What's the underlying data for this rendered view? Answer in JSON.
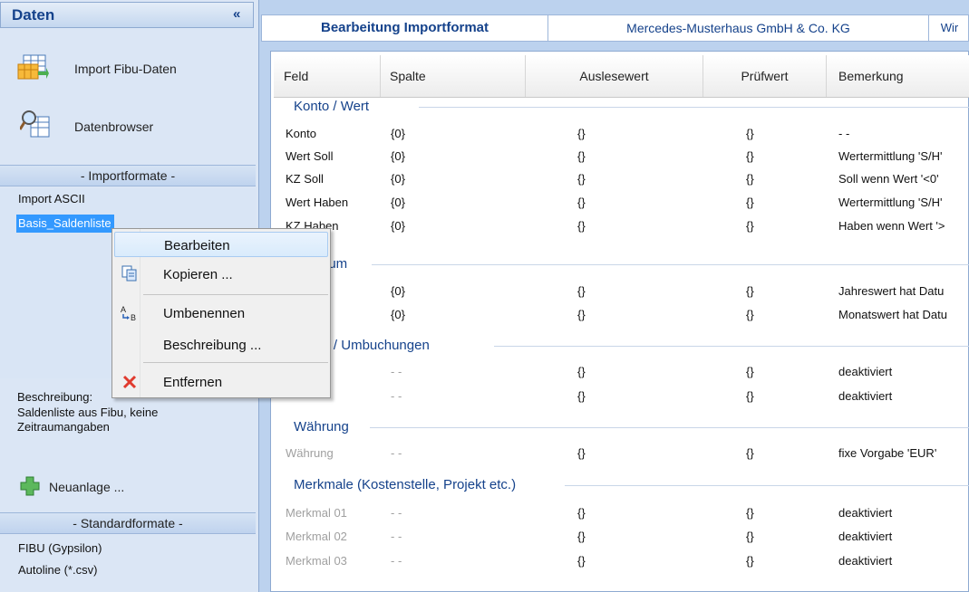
{
  "left": {
    "title": "Daten",
    "collapse": "«",
    "nav": [
      {
        "label": "Import Fibu-Daten",
        "icon": "table-import-icon"
      },
      {
        "label": "Datenbrowser",
        "icon": "data-search-icon"
      }
    ],
    "importformate_title": "- Importformate -",
    "importformate": [
      "Import ASCII",
      "Basis_Saldenliste"
    ],
    "description_label": "Beschreibung:",
    "description_text": [
      "Saldenliste aus Fibu, keine",
      "Zeitraumangaben"
    ],
    "new_label": "Neuanlage ...",
    "standardformate_title": "- Standardformate -",
    "standardformate": [
      "FIBU (Gypsilon)",
      "Autoline (*.csv)"
    ]
  },
  "header": {
    "title": "Bearbeitung Importformat",
    "company": "Mercedes-Musterhaus GmbH & Co. KG",
    "extra": "Wir"
  },
  "grid": {
    "columns": [
      "Feld",
      "Spalte",
      "Auslesewert",
      "Prüfwert",
      "Bemerkung"
    ],
    "groups": [
      {
        "title": "Konto / Wert",
        "rows": [
          [
            "Konto",
            "{0}",
            "{}",
            "{}",
            "- -"
          ],
          [
            "Wert Soll",
            "{0}",
            "{}",
            "{}",
            "Wertermittlung 'S/H'"
          ],
          [
            "KZ Soll",
            "{0}",
            "{}",
            "{}",
            "Soll wenn Wert '<0'"
          ],
          [
            "Wert Haben",
            "{0}",
            "{}",
            "{}",
            "Wertermittlung 'S/H'"
          ],
          [
            "KZ Haben",
            "{0}",
            "{}",
            "{}",
            "Haben wenn Wert '>"
          ]
        ]
      },
      {
        "title": "Zeitraum",
        "rows": [
          [
            "",
            "{0}",
            "{}",
            "{}",
            "Jahreswert hat Datu"
          ],
          [
            "",
            "{0}",
            "{}",
            "{}",
            "Monatswert hat Datu"
          ]
        ]
      },
      {
        "title": "Werte / Umbuchungen",
        "rows": [
          [
            "",
            "- -",
            "{}",
            "{}",
            "deaktiviert"
          ],
          [
            "",
            "- -",
            "{}",
            "{}",
            "deaktiviert"
          ]
        ]
      },
      {
        "title": "Währung",
        "rows": [
          [
            "Währung",
            "- -",
            "{}",
            "{}",
            "fixe Vorgabe 'EUR'"
          ]
        ]
      },
      {
        "title": "Merkmale (Kostenstelle, Projekt etc.)",
        "rows": [
          [
            "Merkmal 01",
            "- -",
            "{}",
            "{}",
            "deaktiviert"
          ],
          [
            "Merkmal 02",
            "- -",
            "{}",
            "{}",
            "deaktiviert"
          ],
          [
            "Merkmal 03",
            "- -",
            "{}",
            "{}",
            "deaktiviert"
          ]
        ]
      }
    ]
  },
  "context_menu": {
    "items": [
      {
        "label": "Bearbeiten",
        "icon": ""
      },
      {
        "label": "Kopieren ...",
        "icon": "copy-icon"
      },
      {
        "label": "Umbenennen",
        "icon": "rename-icon"
      },
      {
        "label": "Beschreibung ...",
        "icon": ""
      },
      {
        "label": "Entfernen",
        "icon": "delete-icon"
      }
    ]
  }
}
